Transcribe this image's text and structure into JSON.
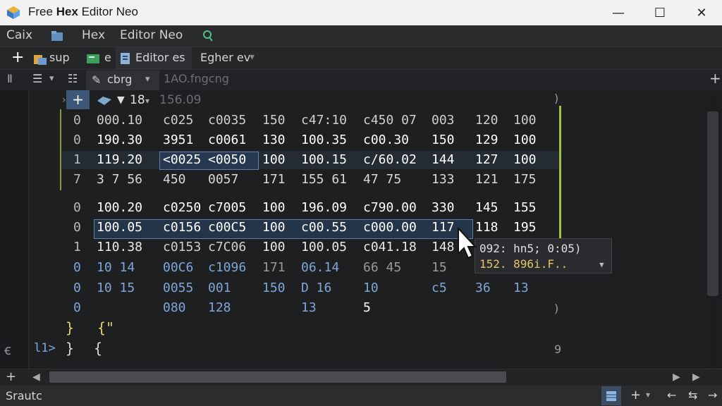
{
  "window": {
    "title_prefix": "Free ",
    "title_bold": "Hex",
    "title_suffix": " Editor Neo",
    "minimize": "—",
    "maximize": "☐",
    "close": "✕"
  },
  "menu": {
    "items": [
      "Caix",
      "Hex",
      "Editor Neo"
    ]
  },
  "toolbar1": {
    "add": "+",
    "item1": "sup",
    "item2": "e",
    "item3": "Editor es",
    "item4": "Egher ev"
  },
  "toolbar2": {
    "encoding_label": "cbrg",
    "search_hint": "1AO.fngcng"
  },
  "editor_header": {
    "add": "+",
    "width": "18",
    "offset": "156.09"
  },
  "rows": [
    {
      "off": "0",
      "cells": [
        "000.10",
        "c025",
        "c0035",
        "150",
        "c47:10",
        "c450 07",
        "003",
        "120",
        "100"
      ]
    },
    {
      "off": "0",
      "cells": [
        "190.30",
        "3951",
        "c0061",
        "130",
        "100.35",
        "c00.30",
        "150",
        "129",
        "100"
      ]
    },
    {
      "off": "1",
      "cells": [
        "119.20",
        "<0025",
        "<0050",
        "100",
        "100.15",
        "c/60.02",
        "144",
        "127",
        "100"
      ]
    },
    {
      "off": "7",
      "cells": [
        "3 7 56",
        "450",
        "0057",
        "171",
        "155 61",
        "47 75",
        "133",
        "121",
        "175"
      ]
    },
    {
      "off": "0",
      "cells": [
        "100.20",
        "c0250",
        "c7005",
        "100",
        "196.09",
        "c790.00",
        "330",
        "145",
        "155"
      ]
    },
    {
      "off": "0",
      "cells": [
        "100.05",
        "c0156",
        "c00C5",
        "100",
        "c00.55",
        "c000.00",
        "117",
        "118",
        "195"
      ]
    },
    {
      "off": "1",
      "cells": [
        "110.38",
        "c0153",
        "c7C06",
        "100",
        "100.05",
        "c041.18",
        "148",
        "",
        ""
      ]
    },
    {
      "off": "0",
      "cells": [
        "10 14",
        "00C6",
        "c1096",
        "171",
        "06.14",
        "66 45",
        "15",
        "",
        ""
      ]
    },
    {
      "off": "0",
      "cells": [
        "10 15",
        "0055",
        "001",
        "150",
        "D 16",
        "10",
        "c5",
        "36",
        "13"
      ]
    },
    {
      "off": "0",
      "cells": [
        "",
        "080",
        "128",
        "",
        "13",
        "5",
        "",
        "",
        ""
      ]
    }
  ],
  "code": {
    "line1_a": "}",
    "line1_b": "{\"",
    "line2_a": "}",
    "line2_b": "{",
    "line2_num": "l1>"
  },
  "tooltip": {
    "line1": "092: hn5; 0:05)",
    "line2": "152. 896i.F.."
  },
  "status": {
    "left": "Srautc"
  }
}
